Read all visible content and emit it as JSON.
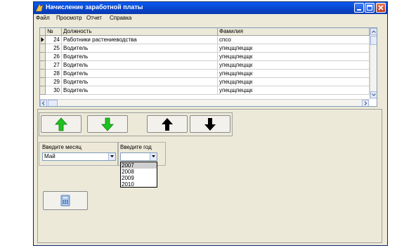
{
  "window": {
    "title": "Начисление заработной платы"
  },
  "menu": [
    "Файл",
    "Просмотр",
    "Отчет",
    "Справка"
  ],
  "grid": {
    "columns": [
      "№",
      "Должность",
      "Фамилия"
    ],
    "rows": [
      {
        "num": "24",
        "position": "Работники растениеводства",
        "surname": "спсо",
        "current": true
      },
      {
        "num": "25",
        "position": "Водитель",
        "surname": "упецщпецщк",
        "current": false
      },
      {
        "num": "26",
        "position": "Водитель",
        "surname": "упецщпецщк",
        "current": false
      },
      {
        "num": "27",
        "position": "Водитель",
        "surname": "упецщпецщк",
        "current": false
      },
      {
        "num": "28",
        "position": "Водитель",
        "surname": "упецщпецщк",
        "current": false
      },
      {
        "num": "29",
        "position": "Водитель",
        "surname": "упецщпецщк",
        "current": false
      },
      {
        "num": "30",
        "position": "Водитель",
        "surname": "упецщпецщк",
        "current": false
      }
    ]
  },
  "nav_buttons": [
    {
      "name": "move-up-green-button",
      "icon": "green-up-arrow-icon",
      "color": "#1ec31e"
    },
    {
      "name": "move-down-green-button",
      "icon": "green-down-arrow-icon",
      "color": "#1ec31e"
    },
    {
      "name": "move-up-black-button",
      "icon": "black-up-arrow-icon",
      "color": "#000000"
    },
    {
      "name": "move-down-black-button",
      "icon": "black-down-arrow-icon",
      "color": "#000000"
    }
  ],
  "month": {
    "label": "Введите месяц",
    "value": "Май"
  },
  "year": {
    "label": "Введите год",
    "value": "",
    "options": [
      "2007",
      "2008",
      "2009",
      "2010"
    ],
    "highlighted": "2007"
  },
  "calc_button": {
    "icon": "calculator-icon"
  }
}
